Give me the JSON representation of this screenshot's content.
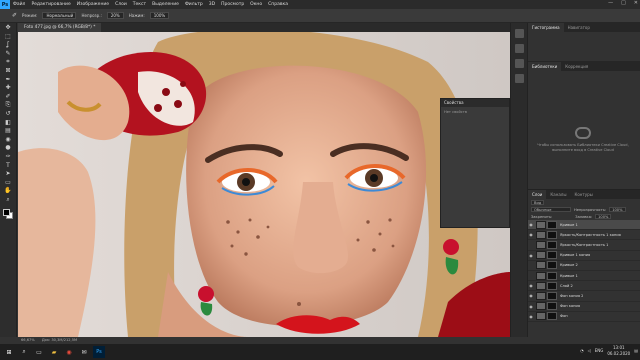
{
  "menubar": {
    "logo": "Ps",
    "items": [
      "Файл",
      "Редактирование",
      "Изображение",
      "Слои",
      "Текст",
      "Выделение",
      "Фильтр",
      "3D",
      "Просмотр",
      "Окно",
      "Справка"
    ],
    "window_buttons": [
      "—",
      "□",
      "✕"
    ]
  },
  "options": {
    "mode_label": "Режим:",
    "mode_value": "Нормальный",
    "opacity_label": "Непрозр.:",
    "opacity_value": "20%",
    "pressure_label": "Нажим:",
    "pressure_value": "100%"
  },
  "document": {
    "tab_title": "Foto 477.jpg @ 66,7% (RGB/8*) *",
    "zoom": "66,67%",
    "status": "Док: 30,3M/212,5M"
  },
  "tools": [
    "move-icon",
    "marquee-icon",
    "lasso-icon",
    "quick-select-icon",
    "crop-icon",
    "frame-icon",
    "eyedropper-icon",
    "healing-icon",
    "brush-icon",
    "stamp-icon",
    "history-brush-icon",
    "eraser-icon",
    "gradient-icon",
    "blur-icon",
    "dodge-icon",
    "pen-icon",
    "type-icon",
    "path-select-icon",
    "rectangle-icon",
    "hand-icon",
    "zoom-icon"
  ],
  "tool_glyphs": [
    "✥",
    "⬚",
    "ʆ",
    "✎",
    "⌗",
    "⊠",
    "✒",
    "✚",
    "✐",
    "⎘",
    "↺",
    "◧",
    "▤",
    "◉",
    "●",
    "✑",
    "T",
    "➤",
    "▭",
    "✋",
    "⌕"
  ],
  "properties": {
    "title": "Свойства",
    "body": "Нет свойств"
  },
  "right": {
    "histogram_tabs": [
      "Гистограмма",
      "Навигатор"
    ],
    "library_tabs": [
      "Библиотеки",
      "Коррекция"
    ],
    "library_message": "Чтобы использовать Библиотеки Creative Cloud, выполните вход в Creative Cloud",
    "layers_tabs": [
      "Слои",
      "Каналы",
      "Контуры"
    ],
    "kind_label": "Вид",
    "blend_mode": "Обычные",
    "opacity_label": "Непрозрачность:",
    "opacity_value": "100%",
    "lock_label": "Закрепить:",
    "fill_label": "Заливка:",
    "fill_value": "100%",
    "layers": [
      {
        "name": "Кривые 1",
        "visible": true,
        "selected": true
      },
      {
        "name": "Яркость/Контрастность 1 копия",
        "visible": true,
        "selected": false
      },
      {
        "name": "Яркость/Контрастность 1",
        "visible": false,
        "selected": false
      },
      {
        "name": "Кривые 1 копия",
        "visible": true,
        "selected": false
      },
      {
        "name": "Кривые 2",
        "visible": false,
        "selected": false
      },
      {
        "name": "Кривые 1",
        "visible": false,
        "selected": false
      },
      {
        "name": "Слой 2",
        "visible": true,
        "selected": false
      },
      {
        "name": "Фон копия 2",
        "visible": true,
        "selected": false
      },
      {
        "name": "Фон копия",
        "visible": true,
        "selected": false
      },
      {
        "name": "Фон",
        "visible": true,
        "selected": false
      }
    ]
  },
  "taskbar": {
    "lang": "ENG",
    "time": "13:01",
    "date": "06.02.2020"
  }
}
